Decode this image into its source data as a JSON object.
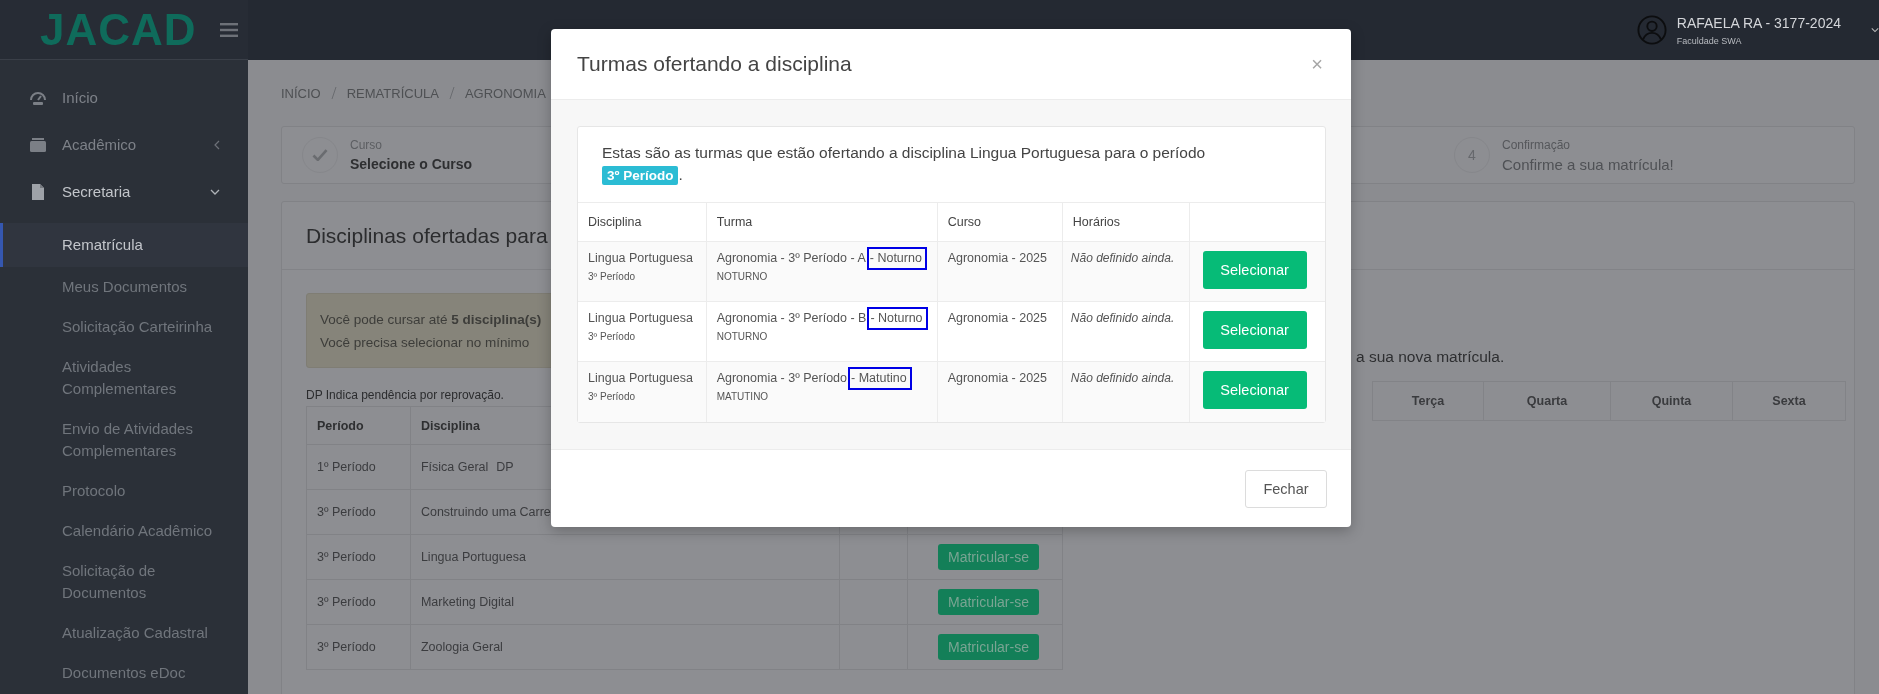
{
  "topbar": {
    "logo": "JACAD",
    "user_name": "RAFAELA RA - 3177-2024",
    "institution": "Faculdade SWA"
  },
  "sidebar": {
    "items": [
      {
        "label": "Início",
        "kind": "link"
      },
      {
        "label": "Acadêmico",
        "kind": "group",
        "expanded": false
      },
      {
        "label": "Secretaria",
        "kind": "group",
        "expanded": true,
        "children": [
          {
            "label": "Rematrícula",
            "selected": true
          },
          {
            "label": "Meus Documentos",
            "selected": false
          },
          {
            "label": "Solicitação Carteirinha",
            "selected": false
          },
          {
            "label": "Atividades Complementares",
            "selected": false
          },
          {
            "label": "Envio de Atividades Complementares",
            "selected": false
          },
          {
            "label": "Protocolo",
            "selected": false
          },
          {
            "label": "Calendário Acadêmico",
            "selected": false
          },
          {
            "label": "Solicitação de Documentos",
            "selected": false
          },
          {
            "label": "Atualização Cadastral",
            "selected": false
          },
          {
            "label": "Documentos eDoc",
            "selected": false
          }
        ]
      }
    ]
  },
  "breadcrumb": [
    "INÍCIO",
    "REMATRÍCULA",
    "AGRONOMIA"
  ],
  "steps": [
    {
      "kind": "done",
      "caption": "Curso",
      "title": "Selecione o Curso"
    },
    {
      "kind": "pending",
      "number": "4",
      "caption": "Confirmação",
      "title": "Confirme a sua matrícula!"
    }
  ],
  "panel": {
    "title": "Disciplinas ofertadas para",
    "alert": [
      "Você pode cursar até **5 disciplina(s)**",
      "Você precisa selecionar no mínimo"
    ],
    "note": "DP Indica pendência por reprovação.",
    "columns": [
      "Período",
      "Disciplina"
    ],
    "rows": [
      {
        "period": "1º Período",
        "subject": "Física Geral",
        "tag": "DP"
      },
      {
        "period": "3º Período",
        "subject": "Construindo uma Carre"
      },
      {
        "period": "3º Período",
        "subject": "Lingua Portuguesa",
        "action": "Matricular-se"
      },
      {
        "period": "3º Período",
        "subject": "Marketing Digital",
        "action": "Matricular-se"
      },
      {
        "period": "3º Período",
        "subject": "Zoologia Geral",
        "action": "Matricular-se"
      }
    ],
    "schedule_hint": "a sua nova matrícula.",
    "schedule_days": [
      "Terça",
      "Quarta",
      "Quinta",
      "Sexta"
    ]
  },
  "modal": {
    "title": "Turmas ofertando a disciplina",
    "close": "×",
    "intro": "Estas são as turmas que estão ofertando a disciplina Lingua Portuguesa para o período",
    "period_badge": "3º Período",
    "intro_end": ".",
    "columns": [
      "Disciplina",
      "Turma",
      "Curso",
      "Horários"
    ],
    "rows": [
      {
        "subject": "Lingua Portuguesa",
        "subject_period": "3º Período",
        "class_head": "Agronomia - 3º Período - A",
        "class_marked": "- Noturno",
        "highlighted": true,
        "shift": "NOTURNO",
        "course": "Agronomia - 2025",
        "schedule": "Não definido ainda.",
        "button": "Selecionar"
      },
      {
        "subject": "Lingua Portuguesa",
        "subject_period": "3º Período",
        "class_head": "Agronomia - 3º Período - B",
        "class_marked": "- Noturno",
        "highlighted": true,
        "shift": "NOTURNO",
        "course": "Agronomia - 2025",
        "schedule": "Não definido ainda.",
        "button": "Selecionar"
      },
      {
        "subject": "Lingua Portuguesa",
        "subject_period": "3º Período",
        "class_head": "Agronomia - 3º Período",
        "class_marked": "- Matutino",
        "highlighted": true,
        "shift": "MATUTINO",
        "course": "Agronomia - 2025",
        "schedule": "Não definido ainda.",
        "button": "Selecionar"
      }
    ],
    "footer_button": "Fechar"
  }
}
